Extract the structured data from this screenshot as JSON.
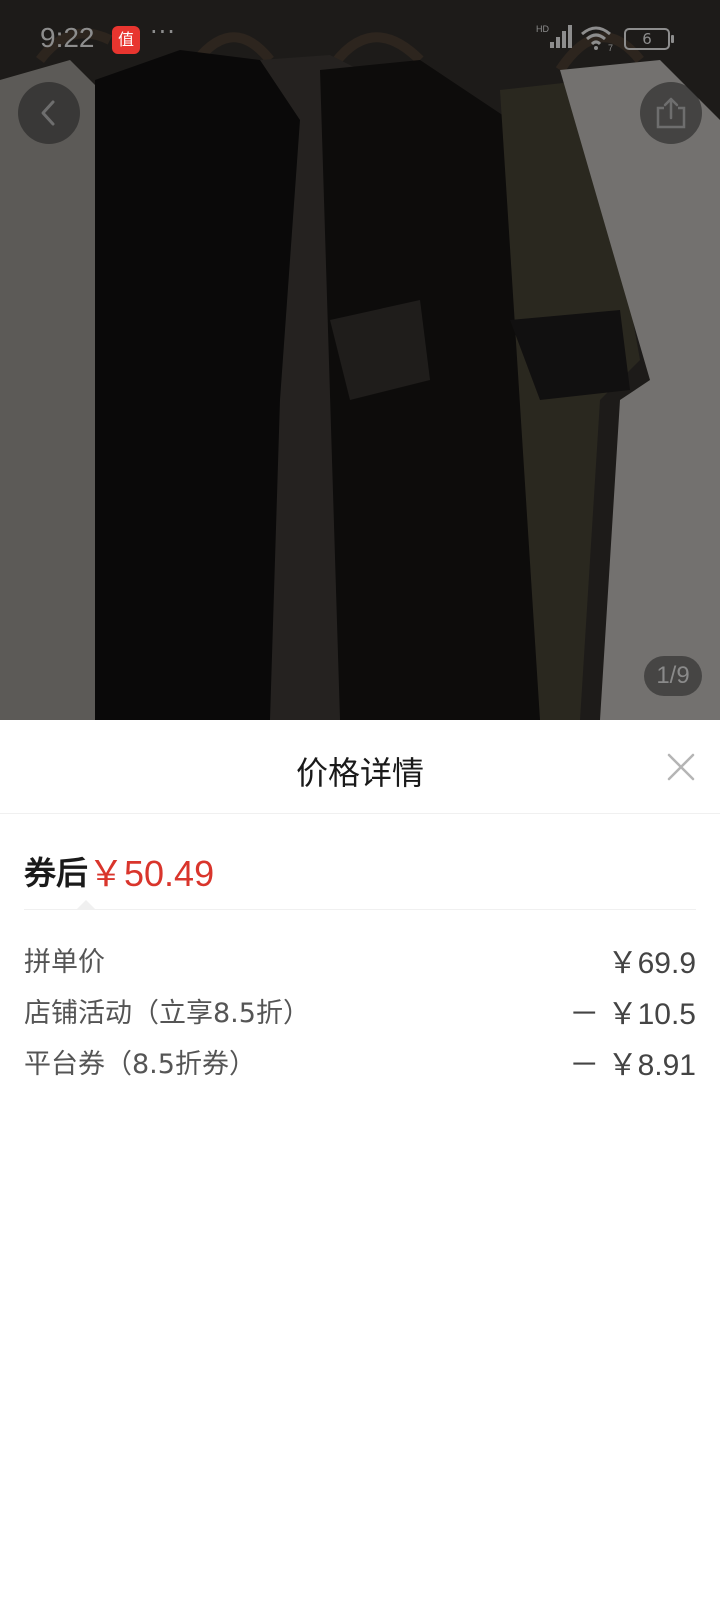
{
  "status_bar": {
    "time": "9:22",
    "notification_badge": "值",
    "more": "···",
    "signal_label": "HD",
    "wifi_label": "7",
    "battery": "6"
  },
  "product_image": {
    "page_indicator": "1/9"
  },
  "price_sheet": {
    "title": "价格详情",
    "summary": {
      "label": "券后",
      "price": "￥50.49"
    },
    "rows": [
      {
        "label": "拼单价",
        "value": "￥69.9"
      },
      {
        "label": "店铺活动（立享8.5折）",
        "value": "－ ￥10.5"
      },
      {
        "label": "平台券（8.5折券）",
        "value": "－ ￥8.91"
      }
    ]
  },
  "colors": {
    "accent_price": "#d9352c",
    "badge": "#e8352f",
    "text_primary": "#1a1a1a",
    "text_secondary": "#555555"
  },
  "icons": {
    "back": "chevron-left-icon",
    "share": "share-icon",
    "close": "close-icon"
  }
}
